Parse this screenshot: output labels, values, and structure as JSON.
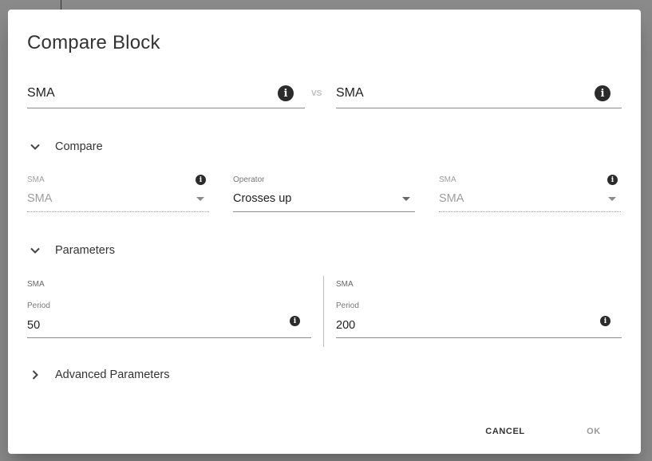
{
  "dialog": {
    "title": "Compare Block",
    "vs_label": "VS"
  },
  "blocks": {
    "left": {
      "value": "SMA"
    },
    "right": {
      "value": "SMA"
    }
  },
  "compare_section": {
    "title": "Compare",
    "expanded": true,
    "left_select": {
      "label": "SMA",
      "value": "SMA",
      "disabled": true
    },
    "operator_select": {
      "label": "Operator",
      "value": "Crosses up",
      "disabled": false
    },
    "right_select": {
      "label": "SMA",
      "value": "SMA",
      "disabled": true
    }
  },
  "parameters_section": {
    "title": "Parameters",
    "expanded": true,
    "left": {
      "title": "SMA",
      "field_label": "Period",
      "value": "50"
    },
    "right": {
      "title": "SMA",
      "field_label": "Period",
      "value": "200"
    }
  },
  "advanced_section": {
    "title": "Advanced Parameters",
    "expanded": false
  },
  "actions": {
    "cancel_label": "CANCEL",
    "ok_label": "OK"
  },
  "icons": {
    "info": "info-icon",
    "expand_more": "chevron-down-icon",
    "expand_collapsed": "chevron-right-icon"
  }
}
